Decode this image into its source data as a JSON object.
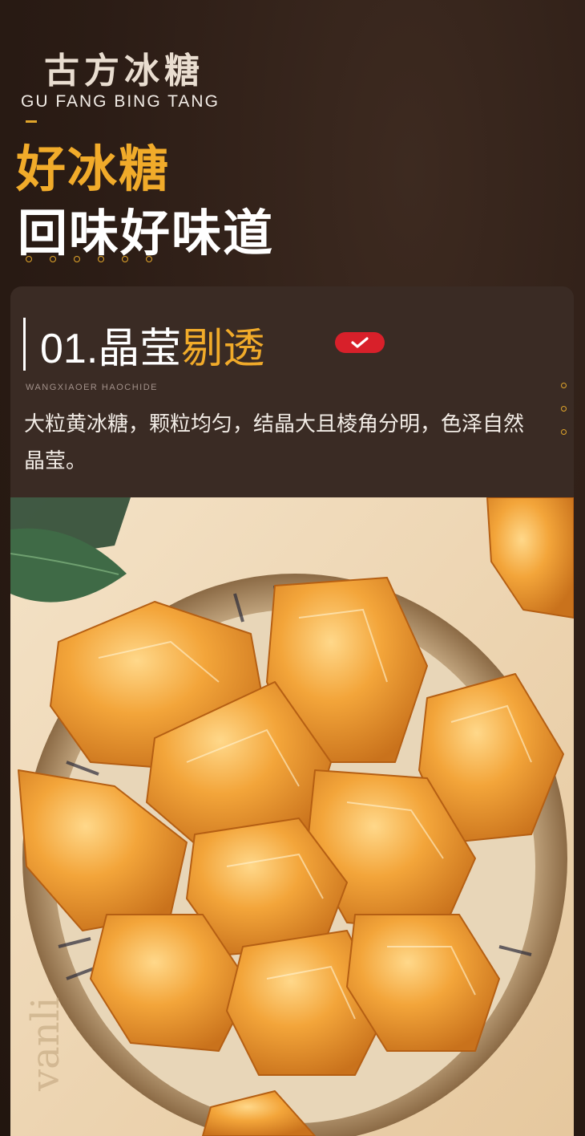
{
  "brand": {
    "title_cn": "古方冰糖",
    "title_pinyin": "GU FANG BING TANG"
  },
  "headline": {
    "line1": "好冰糖",
    "line2": "回味好味道"
  },
  "section": {
    "title_prefix": "01.晶莹",
    "title_accent": "剔透",
    "subtitle": "WANGXIAOER  HAOCHIDE",
    "description": "大粒黄冰糖，颗粒均匀，结晶大且棱角分明，色泽自然晶莹。",
    "badge_icon": "checkmark-icon"
  },
  "photo": {
    "subject": "rock-sugar-bowl-image",
    "board_engraving": "vanli"
  },
  "colors": {
    "accent": "#f1ab2a",
    "background": "#2e1f18",
    "card": "#3a2b24",
    "badge": "#d8202a"
  }
}
